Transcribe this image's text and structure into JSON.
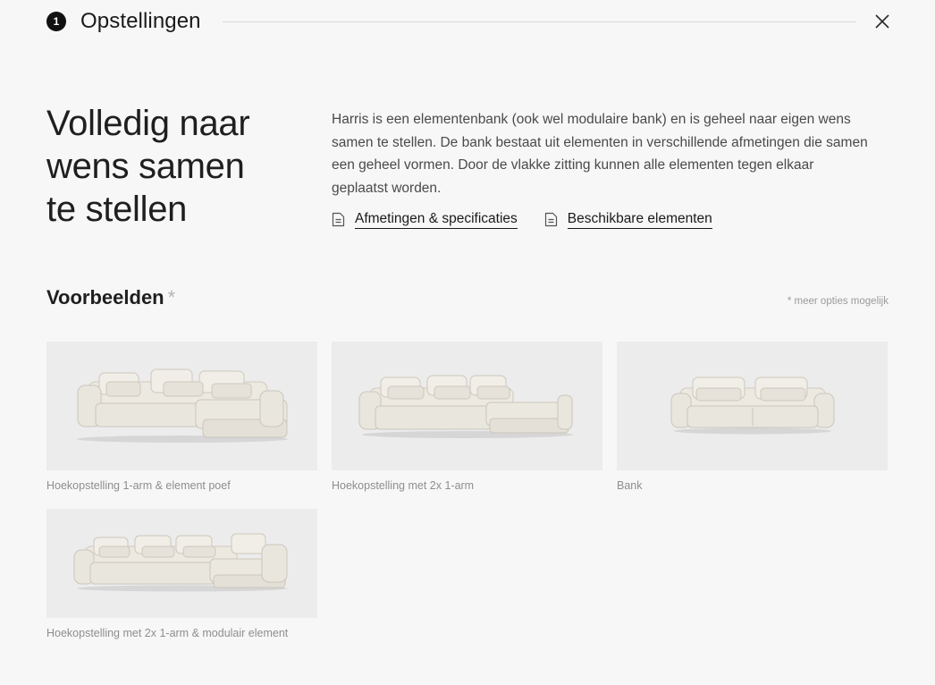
{
  "header": {
    "step": "1",
    "title": "Opstellingen"
  },
  "intro": {
    "heading_lines": [
      "Volledig naar",
      "wens samen",
      "te stellen"
    ],
    "text": "Harris is een elementenbank (ook wel modulaire bank) en is geheel naar eigen wens samen te stellen. De bank bestaat uit elementen in verschillende afmetingen die samen een geheel vormen. Door de vlakke zitting kunnen alle elementen tegen elkaar geplaatst worden.",
    "links": [
      {
        "label": "Afmetingen & specificaties",
        "icon": "document-icon"
      },
      {
        "label": "Beschikbare elementen",
        "icon": "document-icon"
      }
    ]
  },
  "examples": {
    "title": "Voorbeelden",
    "asterisk": "*",
    "note": "* meer opties mogelijk",
    "items": [
      {
        "caption": "Hoekopstelling 1-arm & element poef"
      },
      {
        "caption": "Hoekopstelling met 2x 1-arm"
      },
      {
        "caption": "Bank"
      },
      {
        "caption": "Hoekopstelling met 2x 1-arm & modulair element"
      }
    ]
  },
  "colors": {
    "background": "#f7f7f7",
    "thumb_background": "#ececec",
    "sofa": "#e9e6de",
    "accent": "#111111"
  }
}
